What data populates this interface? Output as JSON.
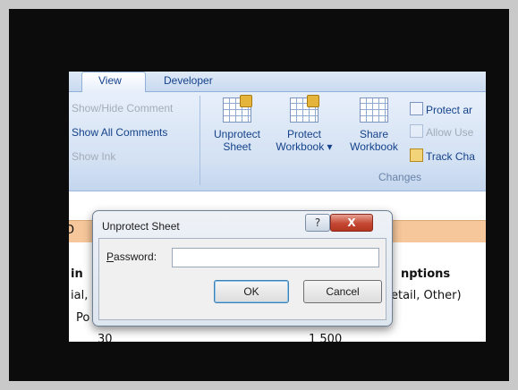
{
  "ribbon": {
    "tabs": [
      {
        "label": "View"
      },
      {
        "label": "Developer"
      }
    ],
    "left_group": {
      "show_hide_comment": "Show/Hide Comment",
      "show_all_comments": "Show All Comments",
      "show_ink": "Show Ink"
    },
    "changes_group": {
      "unprotect_sheet": {
        "line1": "Unprotect",
        "line2": "Sheet"
      },
      "protect_workbook": {
        "line1": "Protect",
        "line2": "Workbook ▾"
      },
      "share_workbook": {
        "line1": "Share",
        "line2": "Workbook"
      },
      "protect_and_share": "Protect ar",
      "allow_users": "Allow Use",
      "track_changes": "Track Cha",
      "label": "Changes"
    }
  },
  "sheet": {
    "left_fragment_1": "in",
    "left_fragment_2": "ial,",
    "left_fragment_3": "Po",
    "left_bar_fragment": "D",
    "right_header": "nptions",
    "right_fragment": "etail, Other)",
    "cell_30": "30",
    "cell_1500": "1 500"
  },
  "dialog": {
    "title": "Unprotect Sheet",
    "help_label": "?",
    "close_label": "X",
    "password_label_u": "P",
    "password_label_rest": "assword:",
    "password_value": "",
    "ok_label": "OK",
    "cancel_label": "Cancel"
  }
}
